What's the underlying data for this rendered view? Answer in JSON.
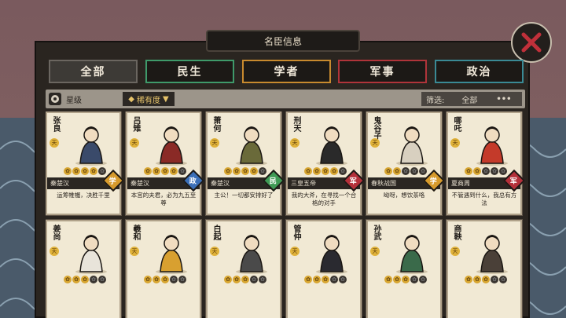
{
  "window": {
    "title": "名臣信息"
  },
  "colors": {
    "tab_all": "#6b6660",
    "tab_minsheng": "#3f9a6a",
    "tab_xuezhe": "#c88a2e",
    "tab_junshi": "#b0343a",
    "tab_zhengzhi": "#3a8a95",
    "badge_xue": "#d69a2c",
    "badge_zheng": "#3b6fb8",
    "badge_min": "#3f9a55",
    "badge_jun": "#b4303a"
  },
  "tabs": [
    {
      "label": "全部",
      "active": true
    },
    {
      "label": "民生",
      "active": false
    },
    {
      "label": "学者",
      "active": false
    },
    {
      "label": "军事",
      "active": false
    },
    {
      "label": "政治",
      "active": false
    }
  ],
  "filters": {
    "star_label": "星级",
    "rarity_label": "稀有度",
    "screen_label": "筛选:",
    "screen_value": "全部",
    "more_icon": "ellipsis-icon"
  },
  "rarity_mark": "天",
  "cards": [
    {
      "name": "张良",
      "stars_on": 4,
      "stars_total": 5,
      "era": "秦楚汉",
      "category": "学",
      "quote": "运筹帷幄，决胜千里",
      "robe": "#3a4a6a"
    },
    {
      "name": "吕雉",
      "stars_on": 4,
      "stars_total": 5,
      "era": "秦楚汉",
      "category": "政",
      "quote": "本宫的夫君，必为九五至尊",
      "robe": "#8a2a26"
    },
    {
      "name": "萧何",
      "stars_on": 4,
      "stars_total": 5,
      "era": "秦楚汉",
      "category": "民",
      "quote": "主公！一切都安排好了",
      "robe": "#6a6a3a"
    },
    {
      "name": "刑天",
      "stars_on": 4,
      "stars_total": 5,
      "era": "三皇五帝",
      "category": "军",
      "quote": "我的大斧，在寻找一个合格的对手",
      "robe": "#2a2a2a"
    },
    {
      "name": "鬼谷子",
      "stars_on": 2,
      "stars_total": 5,
      "era": "春秋战国",
      "category": "学",
      "quote": "呦呀，想饮茶咯",
      "robe": "#d8d0c0"
    },
    {
      "name": "哪吒",
      "stars_on": 2,
      "stars_total": 5,
      "era": "夏商周",
      "category": "军",
      "quote": "不管遇到什么，我总有方法",
      "robe": "#c43a2a"
    },
    {
      "name": "姜尚",
      "stars_on": 3,
      "stars_total": 5,
      "era": "",
      "category": "",
      "quote": "",
      "robe": "#e8e4da"
    },
    {
      "name": "羲和",
      "stars_on": 3,
      "stars_total": 5,
      "era": "",
      "category": "",
      "quote": "",
      "robe": "#d8a030"
    },
    {
      "name": "白起",
      "stars_on": 3,
      "stars_total": 5,
      "era": "",
      "category": "",
      "quote": "",
      "robe": "#4a4a4a"
    },
    {
      "name": "管仲",
      "stars_on": 3,
      "stars_total": 5,
      "era": "",
      "category": "",
      "quote": "",
      "robe": "#2a2a30"
    },
    {
      "name": "孙武",
      "stars_on": 3,
      "stars_total": 5,
      "era": "",
      "category": "",
      "quote": "",
      "robe": "#3a6a4a"
    },
    {
      "name": "商鞅",
      "stars_on": 3,
      "stars_total": 5,
      "era": "",
      "category": "",
      "quote": "",
      "robe": "#4a4038"
    }
  ]
}
